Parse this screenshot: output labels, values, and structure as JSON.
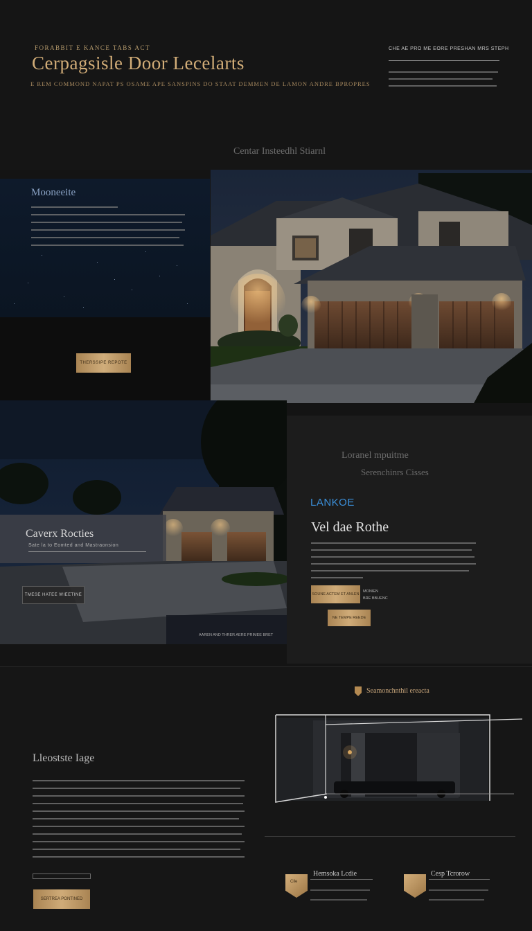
{
  "header": {
    "eyebrow": "FORABBIT E KANCE TABS ACT",
    "brand": "Cerpagsisle Door Lecelarts",
    "tagline": "E REM COMMOND NAPAT PS OSAME APE SANSPINS DO STAAT DEMMEN DE LAMON ANDRE BPROPRES",
    "note_title": "CHE AE PRO ME EORE PRESHAN MRS STEPH"
  },
  "section_label": "Centar Insteedhl Stiarnl",
  "hero": {
    "title": "Mooneeite",
    "cta": "THERSSIPE REPOTE"
  },
  "promo_image": {
    "title": "Caverx Rocties",
    "subtitle": "Sate la to Eomted  and  Mastraonsion",
    "button": "TMESE HATEE WIEETINE",
    "caption": "AAREN AND THRER AERE PRIMEE BRET"
  },
  "panel": {
    "heading": "Loranel mpuitme",
    "subheading": "Serenchinrs Cisses",
    "accent": "LANKOE",
    "title": "Vel dae Rothe",
    "button_primary": "SOUNE ACTEM ET ANLEN",
    "meta_1": "MONIEN",
    "meta_2": "BRE BBUENC",
    "button_secondary": "NE TEMPE REEDE"
  },
  "bottom": {
    "title": "Lleostste Iage",
    "logo_text": "Seamonchnthil ereacta",
    "cta": "SERTREA PONTINED",
    "features": [
      {
        "label": "Hemsoka Lcdie",
        "badge": "Cile"
      },
      {
        "label": "Cesp Tcrorow",
        "badge": ""
      }
    ]
  },
  "colors": {
    "background": "#141414",
    "gold": "#cfab78",
    "accent_blue": "#3b8fd9",
    "night_blue": "#0e1a2b"
  }
}
